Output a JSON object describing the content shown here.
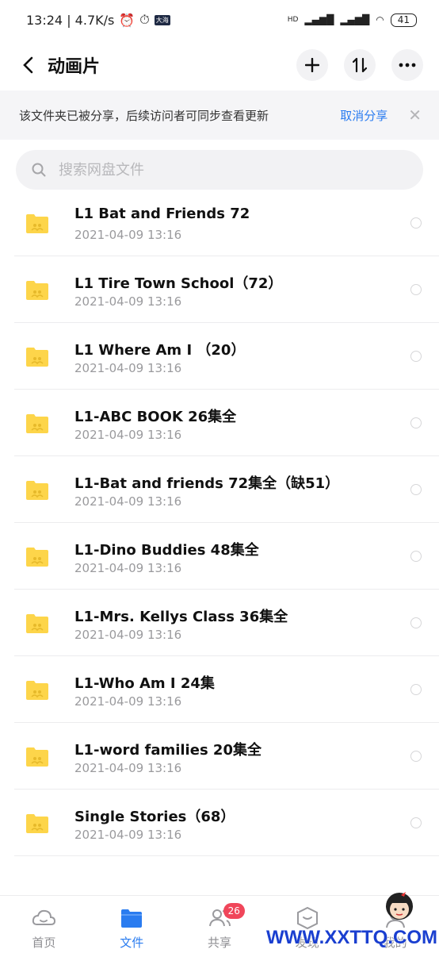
{
  "status": {
    "time_speed": "13:24 | 4.7K/s",
    "badge": "大海",
    "signal_tag": "HD",
    "battery": "41"
  },
  "nav": {
    "title": "动画片"
  },
  "notice": {
    "text": "该文件夹已被分享，后续访问者可同步查看更新",
    "cancel": "取消分享"
  },
  "search": {
    "placeholder": "搜索网盘文件"
  },
  "files": [
    {
      "name": "L1 Bat and Friends 72",
      "date": "2021-04-09  13:16"
    },
    {
      "name": "L1 Tire Town School（72）",
      "date": "2021-04-09  13:16"
    },
    {
      "name": "L1 Where Am I （20）",
      "date": "2021-04-09  13:16"
    },
    {
      "name": "L1-ABC BOOK 26集全",
      "date": "2021-04-09  13:16"
    },
    {
      "name": "L1-Bat and friends 72集全（缺51）",
      "date": "2021-04-09  13:16"
    },
    {
      "name": "L1-Dino Buddies 48集全",
      "date": "2021-04-09  13:16"
    },
    {
      "name": "L1-Mrs. Kellys Class 36集全",
      "date": "2021-04-09  13:16"
    },
    {
      "name": "L1-Who Am I 24集",
      "date": "2021-04-09  13:16"
    },
    {
      "name": "L1-word families 20集全",
      "date": "2021-04-09  13:16"
    },
    {
      "name": "Single Stories（68）",
      "date": "2021-04-09  13:16"
    }
  ],
  "tabs": [
    {
      "label": "首页",
      "icon": "cloud-icon"
    },
    {
      "label": "文件",
      "icon": "folder-icon"
    },
    {
      "label": "共享",
      "icon": "people-icon",
      "badge": "26"
    },
    {
      "label": "发现",
      "icon": "cube-icon"
    },
    {
      "label": "我的",
      "icon": "profile-icon"
    }
  ],
  "watermark": "WWW.XXTTQ.COM",
  "colors": {
    "accent": "#2a7cf0",
    "folder": "#fdd54a",
    "badge": "#f0465a"
  }
}
